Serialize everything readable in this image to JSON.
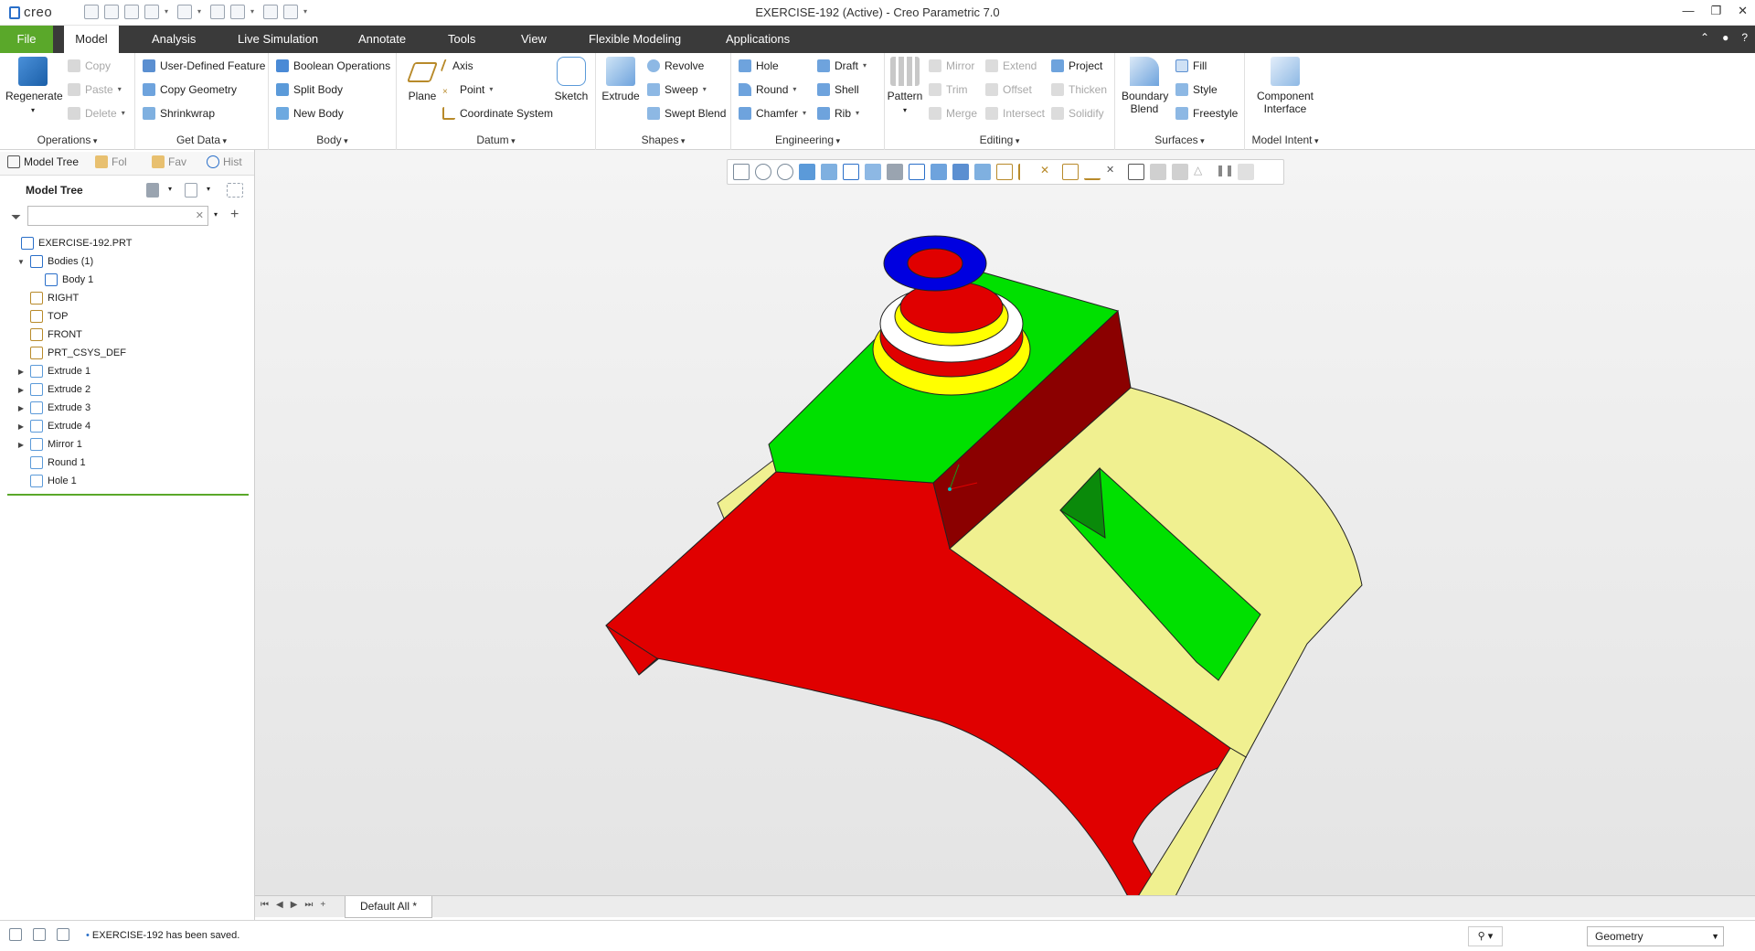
{
  "app": {
    "logo_text": "creo",
    "window_title": "EXERCISE-192 (Active) - Creo Parametric 7.0"
  },
  "ribbon_tabs": [
    "File",
    "Model",
    "Analysis",
    "Live Simulation",
    "Annotate",
    "Tools",
    "View",
    "Flexible Modeling",
    "Applications"
  ],
  "active_tab": "Model",
  "ribbon": {
    "operations": {
      "label": "Operations",
      "regenerate": "Regenerate",
      "copy": "Copy",
      "paste": "Paste",
      "delete": "Delete"
    },
    "get_data": {
      "label": "Get Data",
      "udf": "User-Defined Feature",
      "copy_geometry": "Copy Geometry",
      "shrinkwrap": "Shrinkwrap"
    },
    "body": {
      "label": "Body",
      "boolean": "Boolean Operations",
      "split": "Split Body",
      "new": "New Body"
    },
    "datum": {
      "label": "Datum",
      "plane": "Plane",
      "axis": "Axis",
      "point": "Point",
      "csys": "Coordinate System",
      "sketch": "Sketch"
    },
    "shapes": {
      "label": "Shapes",
      "extrude": "Extrude",
      "revolve": "Revolve",
      "sweep": "Sweep",
      "swept_blend": "Swept Blend"
    },
    "engineering": {
      "label": "Engineering",
      "hole": "Hole",
      "round": "Round",
      "chamfer": "Chamfer",
      "draft": "Draft",
      "shell": "Shell",
      "rib": "Rib"
    },
    "editing": {
      "label": "Editing",
      "pattern": "Pattern",
      "mirror": "Mirror",
      "trim": "Trim",
      "merge": "Merge",
      "extend": "Extend",
      "offset": "Offset",
      "intersect": "Intersect",
      "project": "Project",
      "thicken": "Thicken",
      "solidify": "Solidify"
    },
    "surfaces": {
      "label": "Surfaces",
      "boundary_blend": "Boundary Blend",
      "fill": "Fill",
      "style": "Style",
      "freestyle": "Freestyle"
    },
    "model_intent": {
      "label": "Model Intent",
      "component_interface": "Component Interface"
    }
  },
  "left_tabs": [
    "Model Tree",
    "Fol",
    "Fav",
    "Hist"
  ],
  "model_tree": {
    "title": "Model Tree",
    "search_placeholder": "",
    "items": [
      {
        "label": "EXERCISE-192.PRT",
        "indent": 0,
        "expander": ""
      },
      {
        "label": "Bodies (1)",
        "indent": 1,
        "expander": "▼"
      },
      {
        "label": "Body 1",
        "indent": 2,
        "expander": ""
      },
      {
        "label": "RIGHT",
        "indent": 1,
        "expander": ""
      },
      {
        "label": "TOP",
        "indent": 1,
        "expander": ""
      },
      {
        "label": "FRONT",
        "indent": 1,
        "expander": ""
      },
      {
        "label": "PRT_CSYS_DEF",
        "indent": 1,
        "expander": ""
      },
      {
        "label": "Extrude 1",
        "indent": 1,
        "expander": "▶"
      },
      {
        "label": "Extrude 2",
        "indent": 1,
        "expander": "▶"
      },
      {
        "label": "Extrude 3",
        "indent": 1,
        "expander": "▶"
      },
      {
        "label": "Extrude 4",
        "indent": 1,
        "expander": "▶"
      },
      {
        "label": "Mirror 1",
        "indent": 1,
        "expander": "▶"
      },
      {
        "label": "Round 1",
        "indent": 1,
        "expander": ""
      },
      {
        "label": "Hole 1",
        "indent": 1,
        "expander": ""
      }
    ]
  },
  "document_tab": "Default All *",
  "status": {
    "message": "EXERCISE-192 has been saved.",
    "filter": "Geometry"
  },
  "colors": {
    "file_tab": "#5aa82a",
    "tab_bar": "#3a3a3a",
    "model_red": "#e00000",
    "model_green": "#00e000",
    "model_yellow": "#f0f090",
    "model_blue": "#0000e0"
  }
}
